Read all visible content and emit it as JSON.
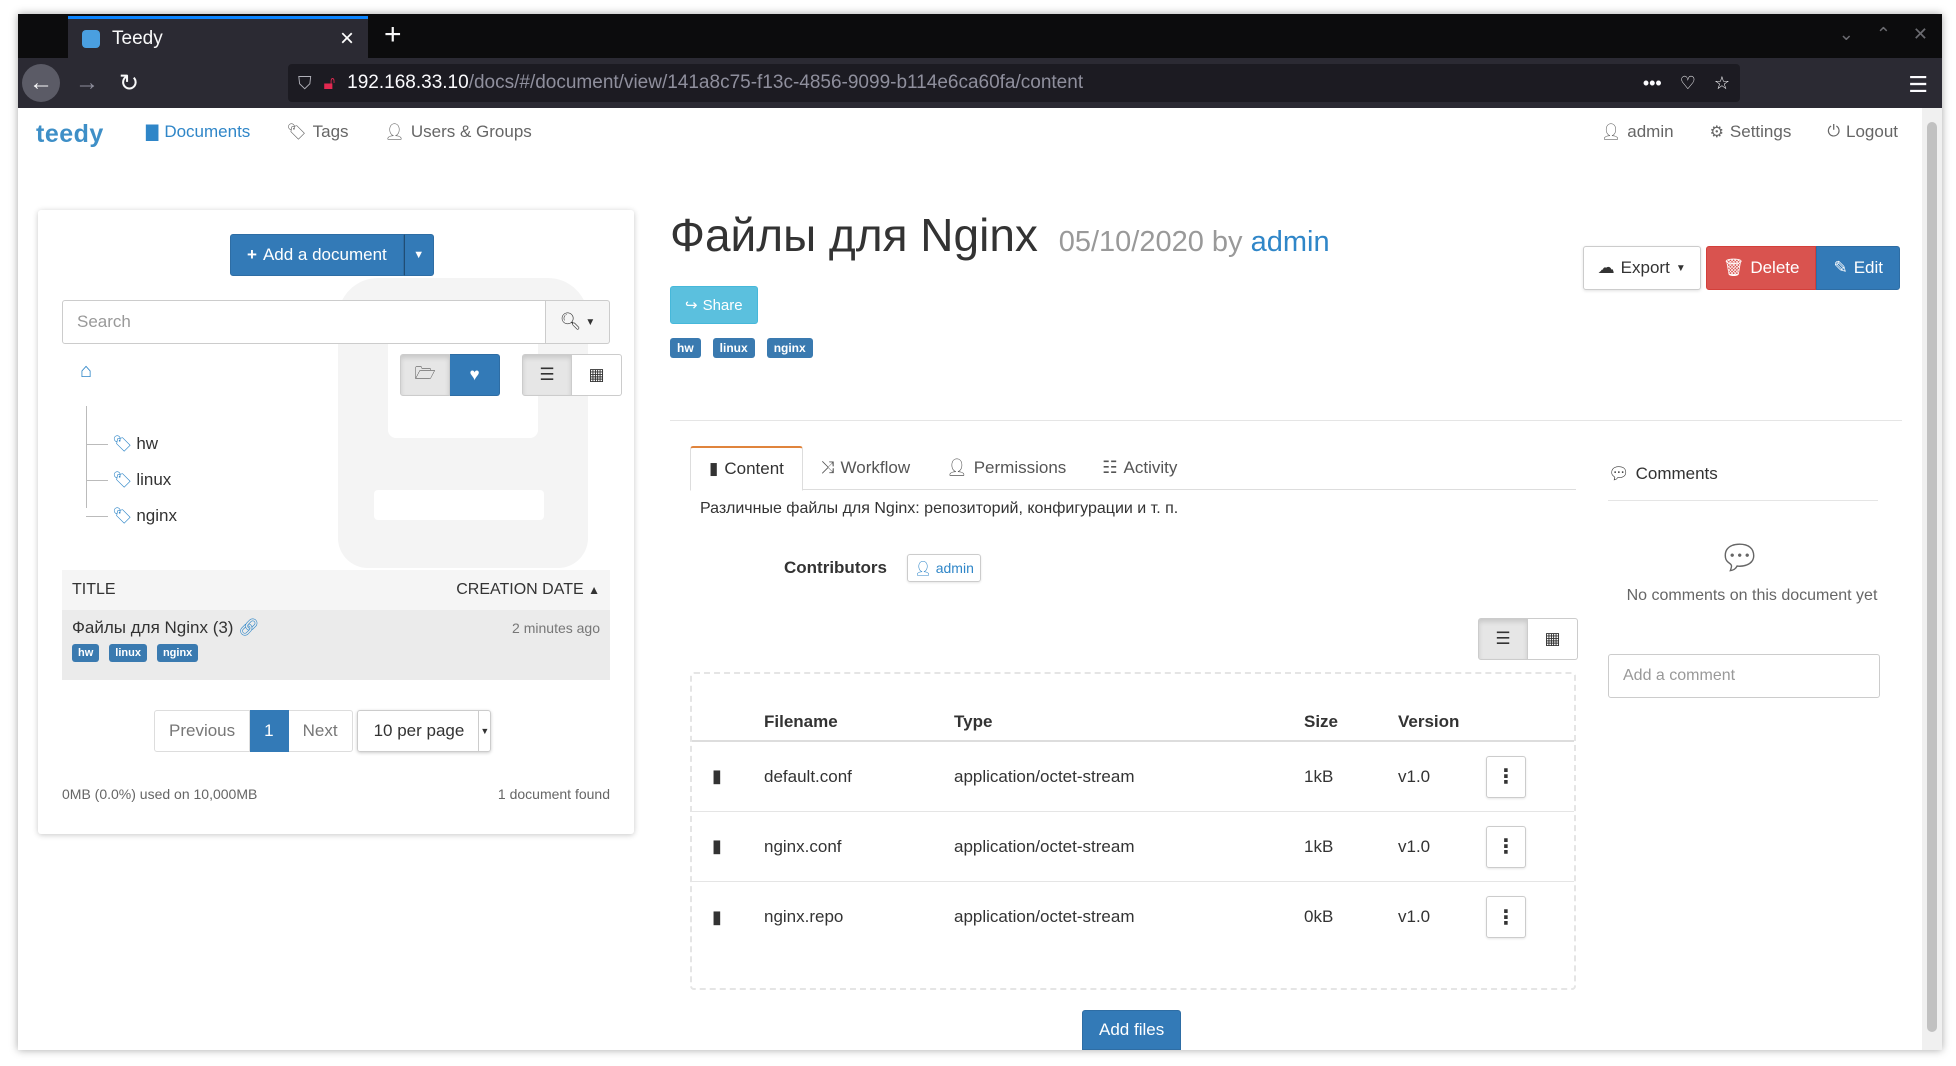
{
  "browser": {
    "tab_title": "Teedy",
    "tab_close": "×",
    "new_tab": "+",
    "url_host": "192.168.33.10",
    "url_path": "/docs/#/document/view/141a8c75-f13c-4856-9099-b114e6ca60fa/content",
    "url_more": "•••"
  },
  "app": {
    "brand": "teedy",
    "nav": {
      "documents": "Documents",
      "tags": "Tags",
      "users_groups": "Users & Groups",
      "admin": "admin",
      "settings": "Settings",
      "logout": "Logout"
    }
  },
  "sidebar": {
    "add_document": "Add a document",
    "search_placeholder": "Search",
    "tree": [
      "hw",
      "linux",
      "nginx"
    ],
    "table": {
      "col_title": "TITLE",
      "col_date": "CREATION DATE",
      "rows": [
        {
          "title": "Файлы для Nginx (3)",
          "when": "2 minutes ago",
          "tags": [
            "hw",
            "linux",
            "nginx"
          ]
        }
      ]
    },
    "pager": {
      "previous": "Previous",
      "current": "1",
      "next": "Next",
      "per_page": "10 per page"
    },
    "storage": "0MB (0.0%) used on 10,000MB",
    "found": "1 document found"
  },
  "document": {
    "title": "Файлы для Nginx",
    "date": "05/10/2020",
    "by": "by",
    "author": "admin",
    "share": "Share",
    "tags": [
      "hw",
      "linux",
      "nginx"
    ],
    "export": "Export",
    "delete": "Delete",
    "edit": "Edit",
    "tabs": {
      "content": "Content",
      "workflow": "Workflow",
      "permissions": "Permissions",
      "activity": "Activity"
    },
    "description": "Различные файлы для Nginx: репозиторий, конфигурации и т. п.",
    "contributors_label": "Contributors",
    "contributors": [
      "admin"
    ],
    "files": {
      "headers": {
        "filename": "Filename",
        "type": "Type",
        "size": "Size",
        "version": "Version"
      },
      "rows": [
        {
          "name": "default.conf",
          "type": "application/octet-stream",
          "size": "1kB",
          "version": "v1.0"
        },
        {
          "name": "nginx.conf",
          "type": "application/octet-stream",
          "size": "1kB",
          "version": "v1.0"
        },
        {
          "name": "nginx.repo",
          "type": "application/octet-stream",
          "size": "0kB",
          "version": "v1.0"
        }
      ]
    },
    "add_files": "Add files"
  },
  "comments": {
    "title": "Comments",
    "empty": "No comments on this document yet",
    "placeholder": "Add a comment"
  },
  "colors": {
    "primary": "#337ab7",
    "danger": "#d9534f",
    "info": "#5bc0de",
    "tab_accent": "#e0843c",
    "brand": "#3e8fc7"
  }
}
